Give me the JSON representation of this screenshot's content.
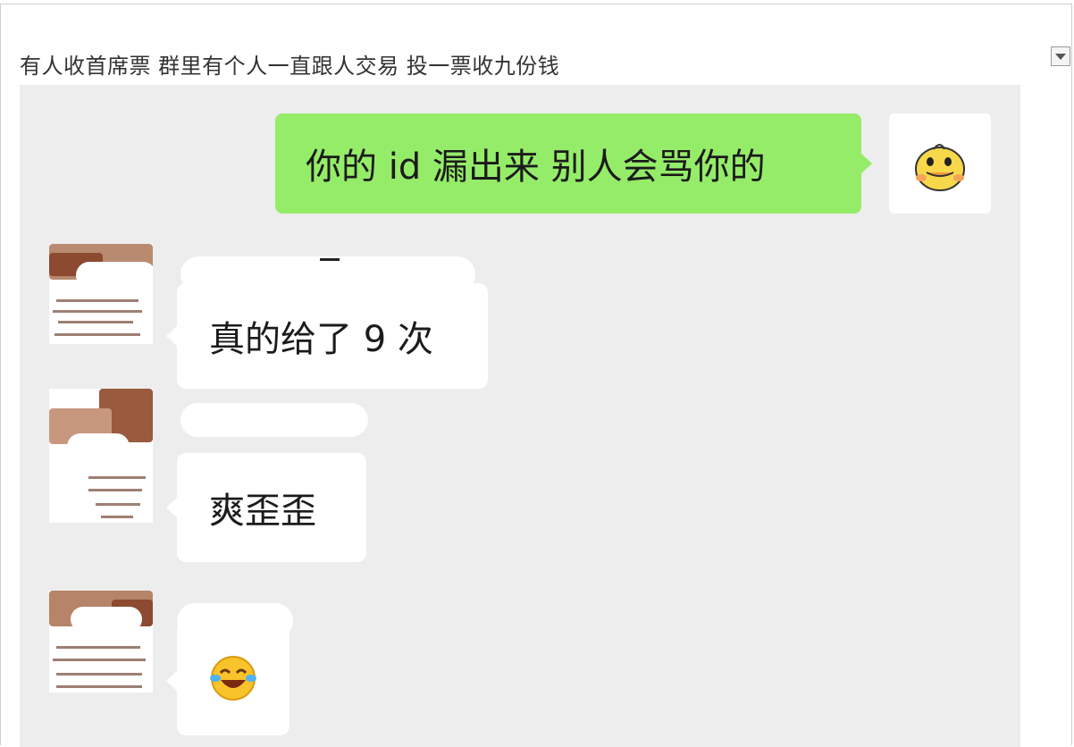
{
  "caption": "有人收首席票 群里有个人一直跟人交易 投一票收九份钱",
  "chat": {
    "background": "#ededed",
    "messages": [
      {
        "side": "right",
        "text": "你的 id 漏出来 别人会骂你的",
        "bubble_color": "#95ec69",
        "avatar_icon": "duck-sticker-icon"
      },
      {
        "side": "left",
        "text": "真的给了 9 次",
        "bubble_color": "#ffffff",
        "avatar_icon": "blurred-avatar"
      },
      {
        "side": "left",
        "text": "爽歪歪",
        "bubble_color": "#ffffff",
        "avatar_icon": "blurred-avatar"
      },
      {
        "side": "left",
        "text": "",
        "emoji": "laughing-crying-emoji-icon",
        "bubble_color": "#ffffff",
        "avatar_icon": "blurred-avatar"
      }
    ]
  },
  "controls": {
    "dropdown_icon": "chevron-down-icon"
  }
}
